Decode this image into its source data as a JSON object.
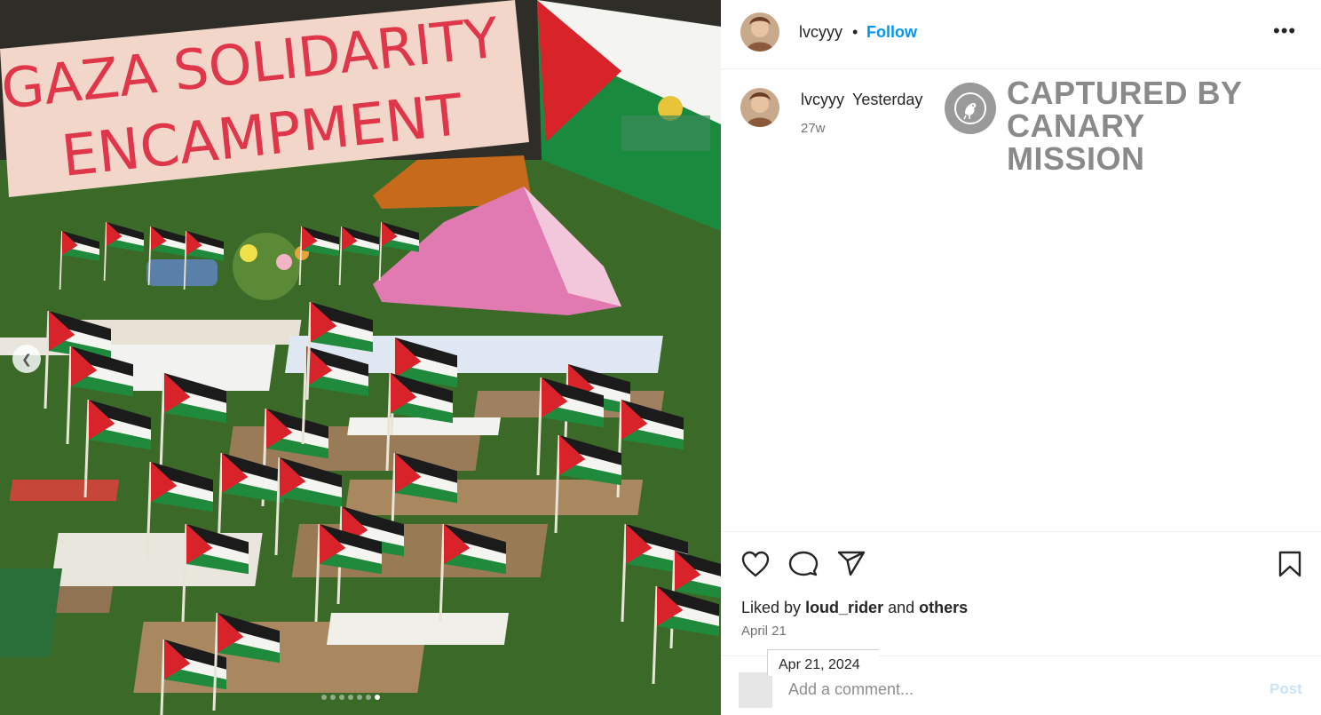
{
  "photo": {
    "banner_line1": "GAZA SOLIDARITY",
    "banner_line2": "ENCAMPMENT",
    "prev_icon": "chevron-left-icon",
    "carousel_count": 7,
    "carousel_active": 7
  },
  "header": {
    "username": "lvcyyy",
    "separator": "•",
    "follow_label": "Follow",
    "more_icon": "•••"
  },
  "caption": {
    "username": "lvcyyy",
    "text": "Yesterday",
    "age": "27w"
  },
  "watermark": {
    "line1": "CAPTURED BY",
    "line2": "CANARY MISSION"
  },
  "actions": {
    "icons": [
      "heart-icon",
      "comment-icon",
      "share-icon",
      "bookmark-icon"
    ],
    "liked_prefix": "Liked by",
    "liked_user": "loud_rider",
    "liked_and": "and",
    "liked_others": "others",
    "date": "April 21",
    "tooltip": "Apr 21, 2024"
  },
  "comment": {
    "placeholder": "Add a comment...",
    "post_label": "Post"
  },
  "colors": {
    "follow": "#0095f6",
    "post_disabled": "#c7e4fb",
    "flag_red": "#d8232a",
    "flag_green": "#1f8a3b"
  }
}
